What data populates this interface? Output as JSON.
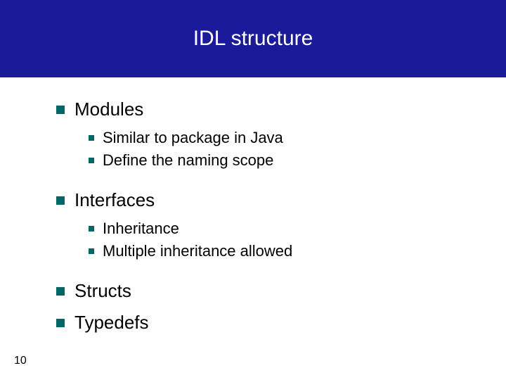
{
  "title": "IDL structure",
  "items": [
    {
      "label": "Modules",
      "children": [
        {
          "label": "Similar to package in Java"
        },
        {
          "label": "Define the naming scope"
        }
      ]
    },
    {
      "label": "Interfaces",
      "children": [
        {
          "label": "Inheritance"
        },
        {
          "label": "Multiple inheritance allowed"
        }
      ]
    },
    {
      "label": "Structs",
      "children": []
    },
    {
      "label": "Typedefs",
      "children": []
    }
  ],
  "pageNumber": "10"
}
